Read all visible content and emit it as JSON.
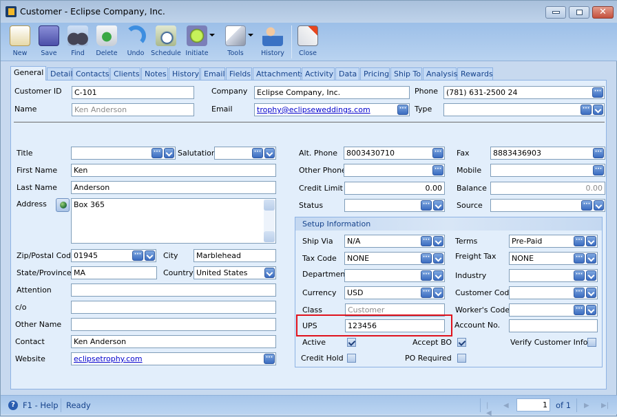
{
  "window": {
    "title": "Customer - Eclipse Company, Inc.",
    "controls": {
      "minimize": "minimize",
      "maximize": "maximize",
      "close": "close"
    }
  },
  "toolbar": {
    "buttons": [
      {
        "label": "New",
        "icon": "new-customer-icon"
      },
      {
        "label": "Save",
        "icon": "floppy-disk-icon"
      },
      {
        "label": "Find",
        "icon": "binoculars-icon"
      },
      {
        "label": "Delete",
        "icon": "recycle-bin-icon"
      },
      {
        "label": "Undo",
        "icon": "undo-arrow-icon"
      },
      {
        "label": "Schedule",
        "icon": "schedule-clock-icon"
      },
      {
        "label": "Initiate",
        "icon": "traffic-light-icon",
        "dropdown": true
      },
      {
        "label": "Tools",
        "icon": "tools-icon",
        "dropdown": true
      },
      {
        "label": "History",
        "icon": "history-person-icon"
      },
      {
        "label": "Close",
        "icon": "close-window-icon"
      }
    ]
  },
  "tabs": [
    "General",
    "Detail",
    "Contacts",
    "Clients",
    "Notes",
    "History",
    "Email",
    "Fields",
    "Attachments",
    "Activity",
    "Data",
    "Pricing",
    "Ship To",
    "Analysis",
    "Rewards"
  ],
  "active_tab": "General",
  "header": {
    "customer_id": {
      "label": "Customer ID",
      "value": "C-101"
    },
    "name": {
      "label": "Name",
      "value": "Ken Anderson"
    },
    "company": {
      "label": "Company",
      "value": "Eclipse Company, Inc."
    },
    "email": {
      "label": "Email",
      "value": "trophy@eclipseweddings.com"
    },
    "phone": {
      "label": "Phone",
      "value": "(781) 631-2500 24"
    },
    "type": {
      "label": "Type",
      "value": ""
    }
  },
  "left": {
    "title": {
      "label": "Title",
      "value": ""
    },
    "salutation": {
      "label": "Salutation",
      "value": ""
    },
    "first_name": {
      "label": "First Name",
      "value": "Ken"
    },
    "last_name": {
      "label": "Last Name",
      "value": "Anderson"
    },
    "address": {
      "label": "Address",
      "value": "Box 365"
    },
    "zip": {
      "label": "Zip/Postal Code",
      "value": "01945"
    },
    "city": {
      "label": "City",
      "value": "Marblehead"
    },
    "state": {
      "label": "State/Province",
      "value": "MA"
    },
    "country": {
      "label": "Country",
      "value": "United States"
    },
    "attention": {
      "label": "Attention",
      "value": ""
    },
    "co": {
      "label": "c/o",
      "value": ""
    },
    "other_name": {
      "label": "Other Name",
      "value": ""
    },
    "contact": {
      "label": "Contact",
      "value": "Ken Anderson"
    },
    "website": {
      "label": "Website",
      "value": "eclipsetrophy.com"
    }
  },
  "right": {
    "alt_phone": {
      "label": "Alt. Phone",
      "value": "8003430710"
    },
    "fax": {
      "label": "Fax",
      "value": "8883436903"
    },
    "other_phone": {
      "label": "Other Phone",
      "value": ""
    },
    "mobile": {
      "label": "Mobile",
      "value": ""
    },
    "credit_limit": {
      "label": "Credit Limit",
      "value": "0.00"
    },
    "balance": {
      "label": "Balance",
      "value": "0.00"
    },
    "status": {
      "label": "Status",
      "value": ""
    },
    "source": {
      "label": "Source",
      "value": ""
    }
  },
  "setup": {
    "title": "Setup Information",
    "ship_via": {
      "label": "Ship Via",
      "value": "N/A"
    },
    "terms": {
      "label": "Terms",
      "value": "Pre-Paid"
    },
    "tax_code": {
      "label": "Tax Code",
      "value": "NONE"
    },
    "freight_tax": {
      "label": "Freight Tax",
      "value": "NONE"
    },
    "department": {
      "label": "Department",
      "value": ""
    },
    "industry": {
      "label": "Industry",
      "value": ""
    },
    "currency": {
      "label": "Currency",
      "value": "USD"
    },
    "customer_code": {
      "label": "Customer Code",
      "value": ""
    },
    "class": {
      "label": "Class",
      "value": "Customer"
    },
    "workers_code": {
      "label": "Worker's Code",
      "value": ""
    },
    "ups": {
      "label": "UPS",
      "value": "123456"
    },
    "account_no": {
      "label": "Account No.",
      "value": ""
    },
    "active": {
      "label": "Active",
      "checked": true
    },
    "accept_bo": {
      "label": "Accept BO",
      "checked": true
    },
    "verify_customer_info": {
      "label": "Verify Customer Info",
      "checked": false
    },
    "credit_hold": {
      "label": "Credit Hold",
      "checked": false
    },
    "po_required": {
      "label": "PO Required",
      "checked": false
    }
  },
  "highlight_color": "#e0101a",
  "statusbar": {
    "help": "F1 - Help",
    "status": "Ready",
    "page": "1",
    "of": "of 1"
  }
}
